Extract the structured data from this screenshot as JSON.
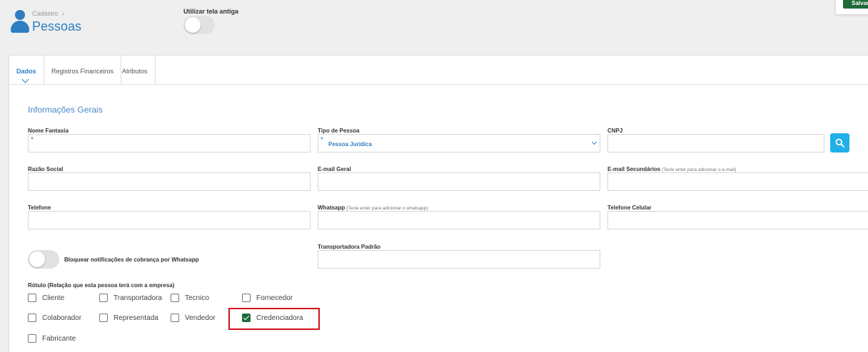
{
  "header": {
    "breadcrumb": "Cadastro",
    "breadcrumb_sep": "›",
    "title": "Pessoas",
    "old_screen_label": "Utilizar tela antiga",
    "old_screen_enabled": false,
    "save_label": "Salvar"
  },
  "tabs": [
    {
      "label": "Dados",
      "active": true
    },
    {
      "label": "Registros Financeiros",
      "active": false
    },
    {
      "label": "Atributos",
      "active": false
    }
  ],
  "section_title": "Informações Gerais",
  "fields": {
    "nome_fantasia": {
      "label": "Nome Fantasia",
      "value": "",
      "required_mark": "*"
    },
    "tipo_pessoa": {
      "label": "Tipo de Pessoa",
      "value": "Pessoa Jurídica",
      "required_mark": "*"
    },
    "cnpj": {
      "label": "CNPJ",
      "value": ""
    },
    "razao_social": {
      "label": "Razão Social",
      "value": ""
    },
    "email_geral": {
      "label": "E-mail Geral",
      "value": ""
    },
    "email_secundarios": {
      "label": "E-mail Secundários",
      "hint": "(Tecle enter para adicionar o e-mail)",
      "value": ""
    },
    "telefone": {
      "label": "Telefone",
      "value": ""
    },
    "whatsapp": {
      "label": "Whatsapp",
      "hint": "(Tecle enter para adicionar o whatsapp)",
      "value": ""
    },
    "telefone_celular": {
      "label": "Telefone Celular",
      "value": ""
    },
    "transportadora_padrao": {
      "label": "Transportadora Padrão",
      "value": ""
    }
  },
  "whatsapp_block": {
    "label": "Bloquear notificações de cobrança por Whatsapp",
    "enabled": false
  },
  "rotulo": {
    "label": "Rótulo (Relação que esta pessoa terá com a empresa)",
    "options": [
      {
        "label": "Cliente",
        "checked": false
      },
      {
        "label": "Transportadora",
        "checked": false
      },
      {
        "label": "Tecnico",
        "checked": false
      },
      {
        "label": "Fornecedor",
        "checked": false
      },
      {
        "label": "Colaborador",
        "checked": false
      },
      {
        "label": "Representada",
        "checked": false
      },
      {
        "label": "Vendedor",
        "checked": false
      },
      {
        "label": "Credenciadora",
        "checked": true
      },
      {
        "label": "Fabricante",
        "checked": false
      }
    ]
  },
  "colors": {
    "accent": "#2f7ec1",
    "save": "#1e6b3a",
    "search": "#21b0e8",
    "highlight": "#d0111b"
  }
}
